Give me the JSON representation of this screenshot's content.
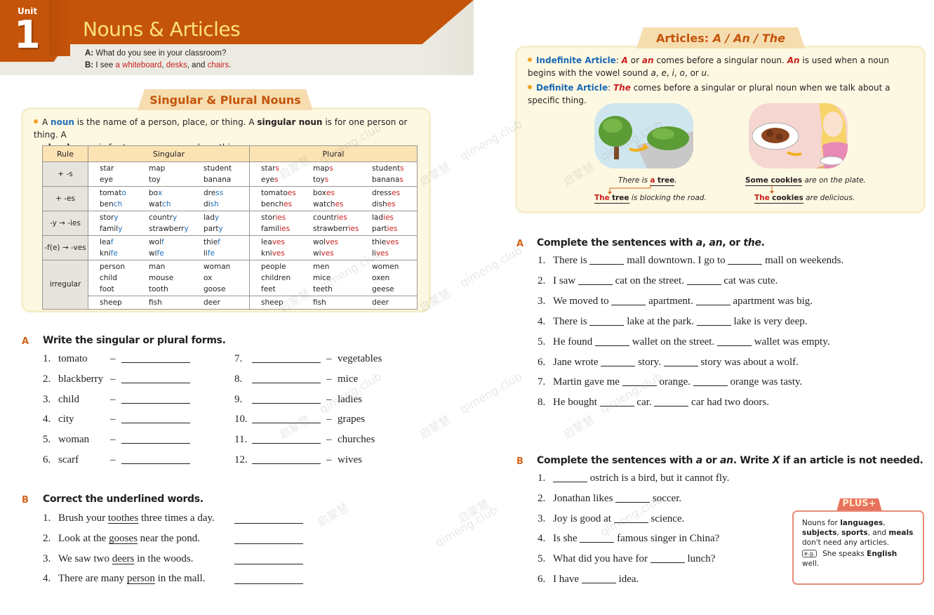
{
  "unit": {
    "label": "Unit",
    "number": "1",
    "title": "Nouns & Articles",
    "dialog": {
      "a_speaker": "A:",
      "a_text": "What do you see in your classroom?",
      "b_speaker": "B:",
      "b_prefix": "I see",
      "b_item1": "a whiteboard",
      "b_sep1": ",",
      "b_item2": "desks",
      "b_sep2": ", and",
      "b_item3": "chairs",
      "b_end": "."
    }
  },
  "singular_plural": {
    "tab_title": "Singular & Plural Nouns",
    "intro": {
      "p1": "A",
      "noun": "noun",
      "p2": "is the name of a person, place, or thing. A",
      "singular_noun": "singular noun",
      "p3": "is for one person or thing. A",
      "plural_noun": "plural noun",
      "p4": "is for two or more people or things."
    },
    "table": {
      "headers": [
        "Rule",
        "Singular",
        "Plural"
      ],
      "groups": [
        {
          "rule": "+ -s",
          "singular": [
            [
              "star",
              "map",
              "student"
            ],
            [
              "eye",
              "toy",
              "banana"
            ]
          ],
          "plural": [
            [
              "star|s",
              "map|s",
              "student|s"
            ],
            [
              "eye|s",
              "toy|s",
              "banana|s"
            ]
          ]
        },
        {
          "rule": "+ -es",
          "singular": [
            [
              "tomat|o",
              "bo|x",
              "dre|ss"
            ],
            [
              "ben|ch",
              "wat|ch",
              "di|sh"
            ]
          ],
          "plural": [
            [
              "tomato|es",
              "box|es",
              "dress|es"
            ],
            [
              "bench|es",
              "watch|es",
              "dish|es"
            ]
          ]
        },
        {
          "rule": "-y → -ies",
          "singular": [
            [
              "stor|y",
              "countr|y",
              "lad|y"
            ],
            [
              "famil|y",
              "strawberr|y",
              "part|y"
            ]
          ],
          "plural": [
            [
              "stor|ies",
              "countr|ies",
              "lad|ies"
            ],
            [
              "famil|ies",
              "strawberr|ies",
              "part|ies"
            ]
          ]
        },
        {
          "rule": "-f(e) → -ves",
          "singular": [
            [
              "lea|f",
              "wol|f",
              "thie|f"
            ],
            [
              "kni|fe",
              "wi|fe",
              "li|fe"
            ]
          ],
          "plural": [
            [
              "lea|ves",
              "wol|ves",
              "thie|ves"
            ],
            [
              "kni|ves",
              "wi|ves",
              "li|ves"
            ]
          ]
        },
        {
          "rule": "irregular",
          "singular": [
            [
              "person",
              "man",
              "woman"
            ],
            [
              "child",
              "mouse",
              "ox"
            ],
            [
              "foot",
              "tooth",
              "goose"
            ]
          ],
          "plural": [
            [
              "people",
              "men",
              "women"
            ],
            [
              "children",
              "mice",
              "oxen"
            ],
            [
              "feet",
              "teeth",
              "geese"
            ]
          ]
        },
        {
          "rule": "",
          "singular": [
            [
              "sheep",
              "fish",
              "deer"
            ]
          ],
          "plural": [
            [
              "sheep",
              "fish",
              "deer"
            ]
          ]
        }
      ]
    }
  },
  "exercise_left_a": {
    "letter": "A",
    "title": "Write the singular or plural forms.",
    "left_items": [
      {
        "num": "1.",
        "word": "tomato"
      },
      {
        "num": "2.",
        "word": "blackberry"
      },
      {
        "num": "3.",
        "word": "child"
      },
      {
        "num": "4.",
        "word": "city"
      },
      {
        "num": "5.",
        "word": "woman"
      },
      {
        "num": "6.",
        "word": "scarf"
      }
    ],
    "right_items": [
      {
        "num": "7.",
        "word": "vegetables"
      },
      {
        "num": "8.",
        "word": "mice"
      },
      {
        "num": "9.",
        "word": "ladies"
      },
      {
        "num": "10.",
        "word": "grapes"
      },
      {
        "num": "11.",
        "word": "churches"
      },
      {
        "num": "12.",
        "word": "wives"
      }
    ],
    "dash": "–"
  },
  "exercise_left_b": {
    "letter": "B",
    "title": "Correct the underlined words.",
    "items": [
      {
        "num": "1.",
        "before": "Brush your",
        "underlined": "toothes",
        "after": "three times a day."
      },
      {
        "num": "2.",
        "before": "Look at the",
        "underlined": "gooses",
        "after": "near the pond."
      },
      {
        "num": "3.",
        "before": "We saw two",
        "underlined": "deers",
        "after": "in the woods."
      },
      {
        "num": "4.",
        "before": "There are many",
        "underlined": "person",
        "after": "in the mall."
      }
    ]
  },
  "articles": {
    "tab_title_prefix": "Articles:",
    "tab_title_italic": "A / An / The",
    "indef": {
      "label": "Indefinite Article",
      "colon": ":",
      "a": "A",
      "or": "or",
      "an": "an",
      "t1": "comes before a singular noun.",
      "An": "An",
      "t2": "is used when a noun begins with the vowel sound",
      "vowels": [
        "a",
        "e",
        "i",
        "o",
        "u"
      ],
      "t3": "or"
    },
    "def": {
      "label": "Definite Article",
      "colon": ":",
      "the": "The",
      "text": "comes before a singular or plural noun when we talk about a specific thing."
    },
    "examples": [
      {
        "line1_prefix": "There is",
        "line1_article": "a",
        "line1_noun": "tree",
        "line1_end": ".",
        "line2_article": "The",
        "line2_noun": "tree",
        "line2_rest": "is blocking the road."
      },
      {
        "line1_bold": "Some cookies",
        "line1_rest": "are on the plate.",
        "line2_article": "The",
        "line2_noun": "cookies",
        "line2_rest": "are delicious."
      }
    ]
  },
  "exercise_right_a": {
    "letter": "A",
    "title_prefix": "Complete the sentences with",
    "title_a": "a",
    "title_sep1": ",",
    "title_an": "an",
    "title_sep2": ", or",
    "title_the": "the",
    "title_end": ".",
    "items": [
      {
        "num": "1.",
        "p1": "There is",
        "p2": "mall downtown. I go to",
        "p3": "mall on weekends."
      },
      {
        "num": "2.",
        "p1": "I saw",
        "p2": "cat on the street.",
        "p3": "cat was cute."
      },
      {
        "num": "3.",
        "p1": "We moved to",
        "p2": "apartment.",
        "p3": "apartment was big."
      },
      {
        "num": "4.",
        "p1": "There is",
        "p2": "lake at the park.",
        "p3": "lake is very deep."
      },
      {
        "num": "5.",
        "p1": "He found",
        "p2": "wallet on the street.",
        "p3": "wallet was empty."
      },
      {
        "num": "6.",
        "p1": "Jane wrote",
        "p2": "story.",
        "p3": "story was about a wolf."
      },
      {
        "num": "7.",
        "p1": "Martin gave me",
        "p2": "orange.",
        "p3": "orange was tasty."
      },
      {
        "num": "8.",
        "p1": "He bought",
        "p2": "car.",
        "p3": "car had two doors."
      }
    ]
  },
  "exercise_right_b": {
    "letter": "B",
    "title_prefix": "Complete the sentences with",
    "title_a": "a",
    "title_or": "or",
    "title_an": "an",
    "title_mid": ". Write",
    "title_x": "X",
    "title_end": "if an article is not needed.",
    "items": [
      {
        "num": "1.",
        "before": "",
        "after": "ostrich is a bird, but it cannot fly."
      },
      {
        "num": "2.",
        "before": "Jonathan likes",
        "after": "soccer."
      },
      {
        "num": "3.",
        "before": "Joy is good at",
        "after": "science."
      },
      {
        "num": "4.",
        "before": "Is she",
        "after": "famous singer in China?"
      },
      {
        "num": "5.",
        "before": "What did you have for",
        "after": "lunch?"
      },
      {
        "num": "6.",
        "before": "I have",
        "after": "idea."
      }
    ]
  },
  "plus_box": {
    "tab": "PLUS+",
    "t1": "Nouns for",
    "b1": "languages",
    "s1": ",",
    "b2": "subjects",
    "s2": ",",
    "b3": "sports",
    "s3": ", and",
    "b4": "meals",
    "t2": "don't need any articles.",
    "eg": "e.g.",
    "ex_prefix": "She speaks",
    "ex_bold": "English",
    "ex_end": "well."
  },
  "watermark": {
    "text_cn": "启蒙慧",
    "text_en": "qimeng.club"
  },
  "colors": {
    "brand_orange": "#c4540a",
    "title_yellow": "#fde27a",
    "highlight_red": "#c8201f",
    "term_blue": "#1a69b5",
    "box_bg": "#fdf8e1",
    "plus_salmon": "#e8715d"
  }
}
